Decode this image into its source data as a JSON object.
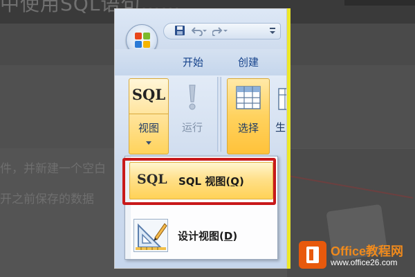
{
  "background_article": {
    "heading_fragment": "中使用SQL语句……",
    "line1": "件，并新建一个空白",
    "line2": "开之前保存的数据"
  },
  "quick_access": {
    "save_icon": "save-icon",
    "undo_icon": "undo-icon",
    "redo_icon": "redo-icon",
    "customize_icon": "customize-menu-icon"
  },
  "tabs": [
    {
      "label": "开始"
    },
    {
      "label": "创建"
    }
  ],
  "ribbon": {
    "view_button": {
      "glyph": "SQL",
      "label": "视图"
    },
    "run_button": {
      "label": "运行"
    },
    "select_button": {
      "label": "选择"
    },
    "partial_button": {
      "label": "生"
    }
  },
  "view_menu": {
    "items": [
      {
        "glyph": "SQL",
        "label": "SQL 视图(",
        "accel": "Q",
        "suffix": ")"
      },
      {
        "label": "设计视图(",
        "accel": "D",
        "suffix": ")"
      }
    ]
  },
  "watermark": {
    "title": "Office教程网",
    "url": "www.office26.com"
  },
  "colors": {
    "highlight": "#c8191a",
    "ribbon_text": "#15428b",
    "hover_gold": "#ffd35b",
    "watermark_orange": "#e8590c"
  }
}
